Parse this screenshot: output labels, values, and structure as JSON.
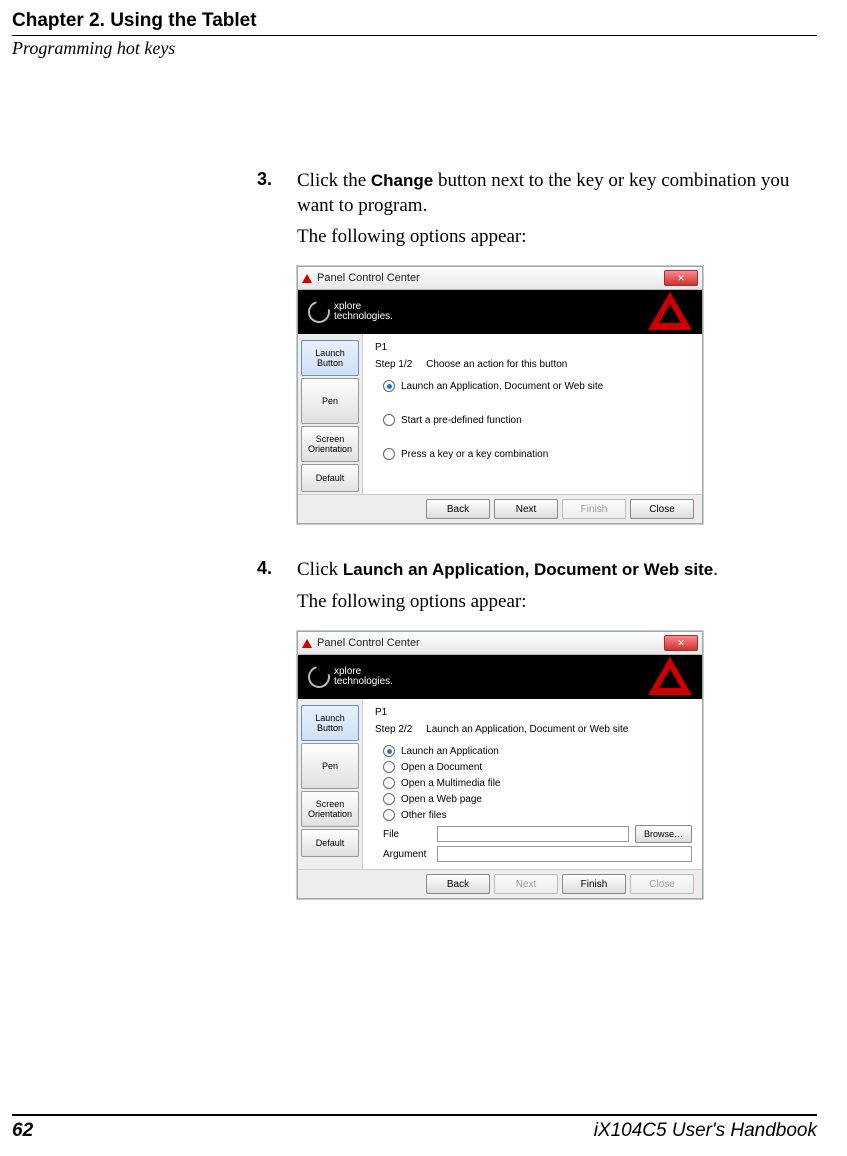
{
  "header": {
    "chapter": "Chapter 2. Using the Tablet",
    "section": "Programming hot keys"
  },
  "step3": {
    "num": "3.",
    "text_a": "Click the ",
    "ui": "Change",
    "text_b": " button next to the key or key combination you want to program.",
    "follow": "The following options appear:"
  },
  "dialog1": {
    "title": "Panel Control Center",
    "brand1": "xplore",
    "brand2": "technologies.",
    "sidebar": [
      "Launch\nButton",
      "Pen",
      "Screen\nOrientation",
      "Default"
    ],
    "p_heading": "P1",
    "step_label": "Step 1/2     Choose an action for this button",
    "options": [
      "Launch an Application, Document or Web site",
      "Start a pre-defined function",
      "Press a key or a key combination"
    ],
    "buttons": {
      "back": "Back",
      "next": "Next",
      "finish": "Finish",
      "close": "Close"
    }
  },
  "step4": {
    "num": "4.",
    "text_a": "Click ",
    "ui": "Launch an Application, Document or Web site",
    "text_b": ".",
    "follow": "The following options appear:"
  },
  "dialog2": {
    "title": "Panel Control Center",
    "brand1": "xplore",
    "brand2": "technologies.",
    "sidebar": [
      "Launch\nButton",
      "Pen",
      "Screen\nOrientation",
      "Default"
    ],
    "p_heading": "P1",
    "step_label": "Step 2/2     Launch an Application, Document or Web site",
    "options": [
      "Launch an Application",
      "Open a Document",
      "Open a Multimedia file",
      "Open a Web page",
      "Other files"
    ],
    "file_label": "File",
    "arg_label": "Argument",
    "browse": "Browse…",
    "buttons": {
      "back": "Back",
      "next": "Next",
      "finish": "Finish",
      "close": "Close"
    }
  },
  "footer": {
    "page": "62",
    "handbook": "iX104C5 User's Handbook"
  }
}
